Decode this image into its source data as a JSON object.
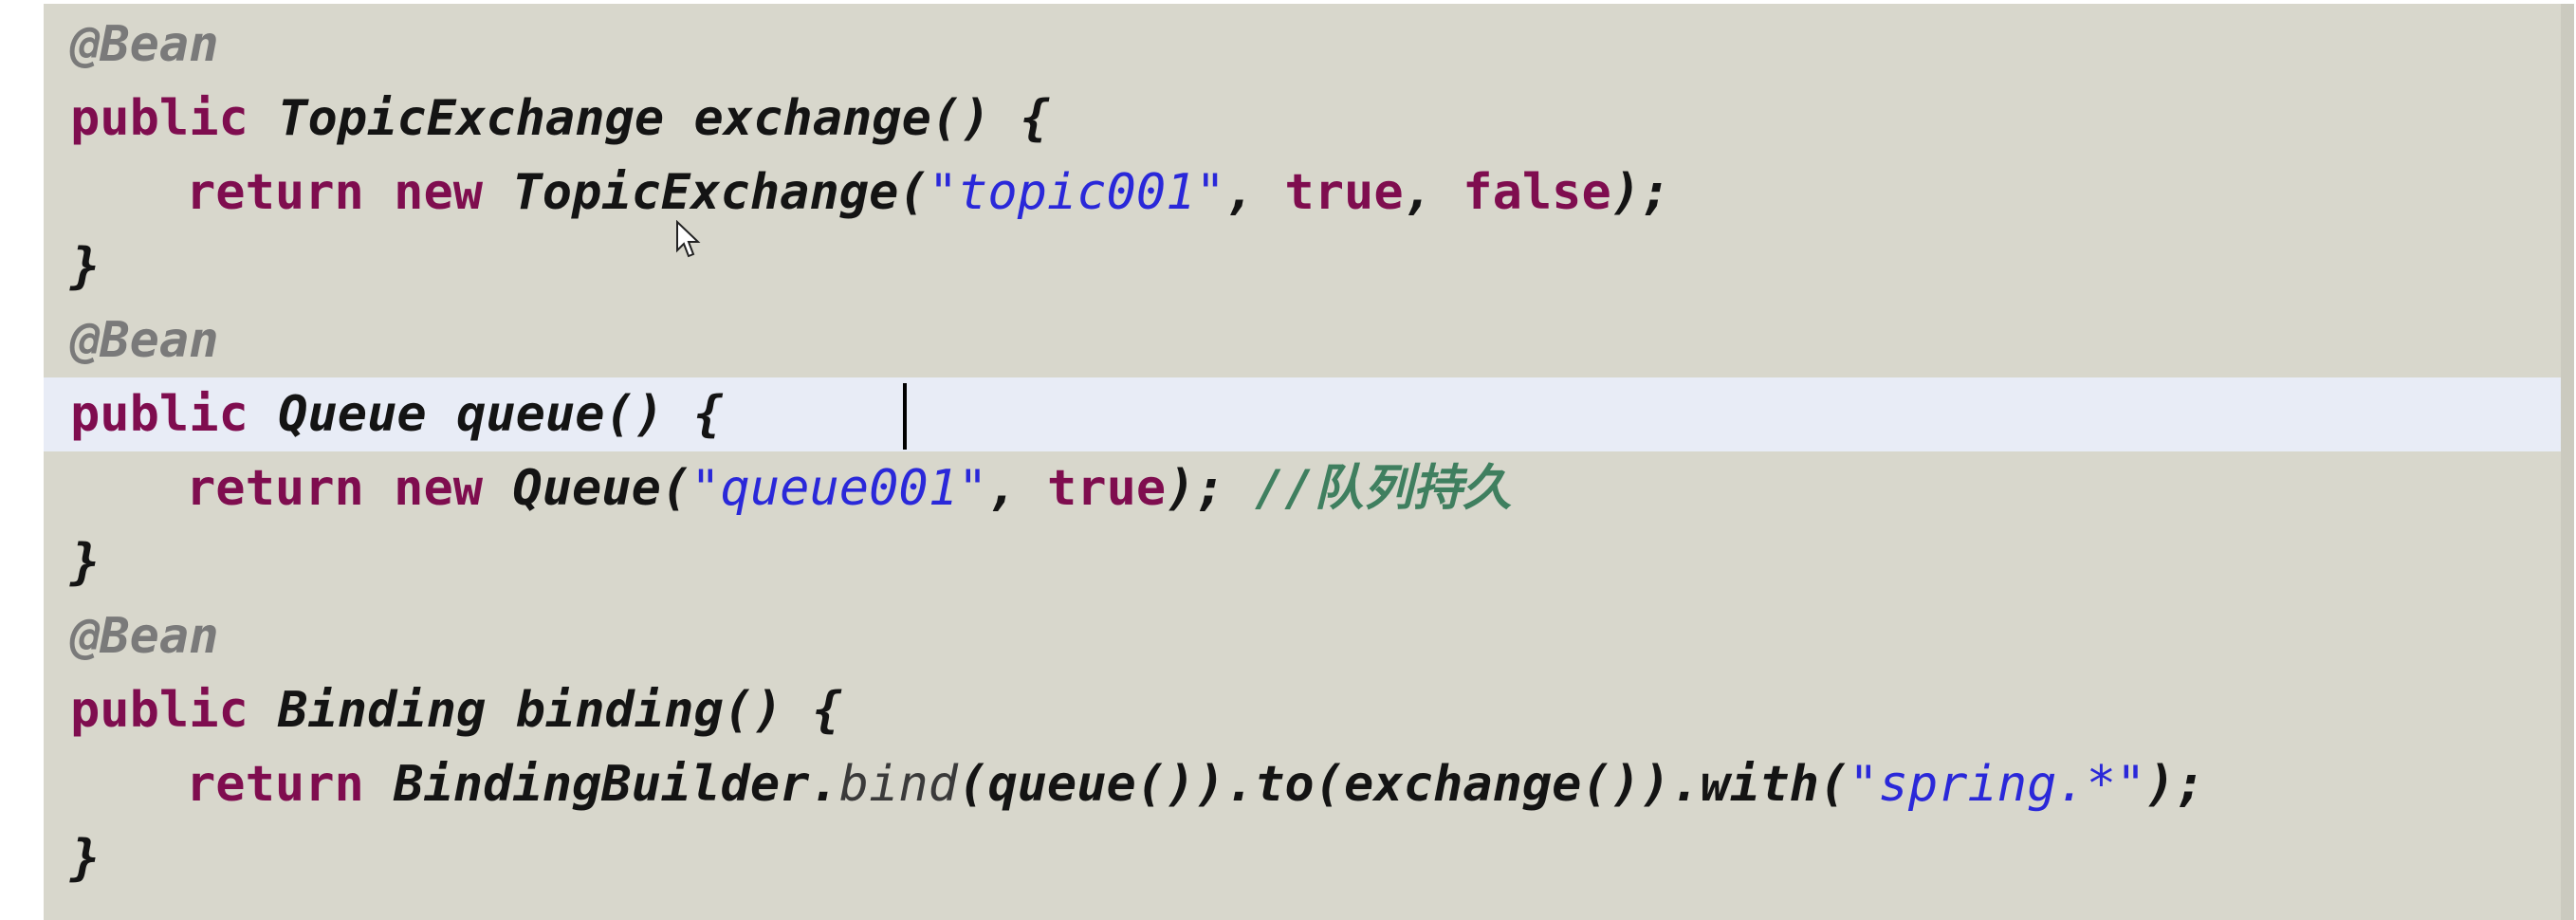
{
  "editor": {
    "lines": [
      {
        "tokens": [
          "@Bean"
        ]
      },
      {
        "tokens": [
          "public",
          "TopicExchange",
          "exchange",
          "()",
          "{"
        ]
      },
      {
        "tokens": [
          "return",
          "new",
          "TopicExchange",
          "(",
          "\"topic001\"",
          ",",
          "true",
          ",",
          "false",
          ");"
        ]
      },
      {
        "tokens": [
          "}"
        ]
      },
      {
        "tokens": [
          "@Bean"
        ]
      },
      {
        "tokens": [
          "public",
          "Queue",
          "queue",
          "()",
          "{"
        ]
      },
      {
        "tokens": [
          "return",
          "new",
          "Queue",
          "(",
          "\"queue001\"",
          ",",
          "true",
          ");",
          "//队列持久"
        ]
      },
      {
        "tokens": [
          "}"
        ]
      },
      {
        "tokens": [
          "@Bean"
        ]
      },
      {
        "tokens": [
          "public",
          "Binding",
          "binding",
          "()",
          "{"
        ]
      },
      {
        "tokens": [
          "return",
          "BindingBuilder",
          ".",
          "bind",
          "(",
          "queue",
          "())",
          ".",
          "to",
          "(",
          "exchange",
          "())",
          ".",
          "with",
          "(",
          "\"spring.*\"",
          ");"
        ]
      },
      {
        "tokens": [
          "}"
        ]
      }
    ]
  },
  "colors": {
    "background": "#d8d7cc",
    "current_line": "#e8ecf6",
    "keyword": "#7f0d4f",
    "string": "#2a28d9",
    "annotation": "#7a7a7a",
    "comment": "#3f7f5f"
  },
  "icons": {
    "cursor": "mouse-pointer-icon"
  }
}
